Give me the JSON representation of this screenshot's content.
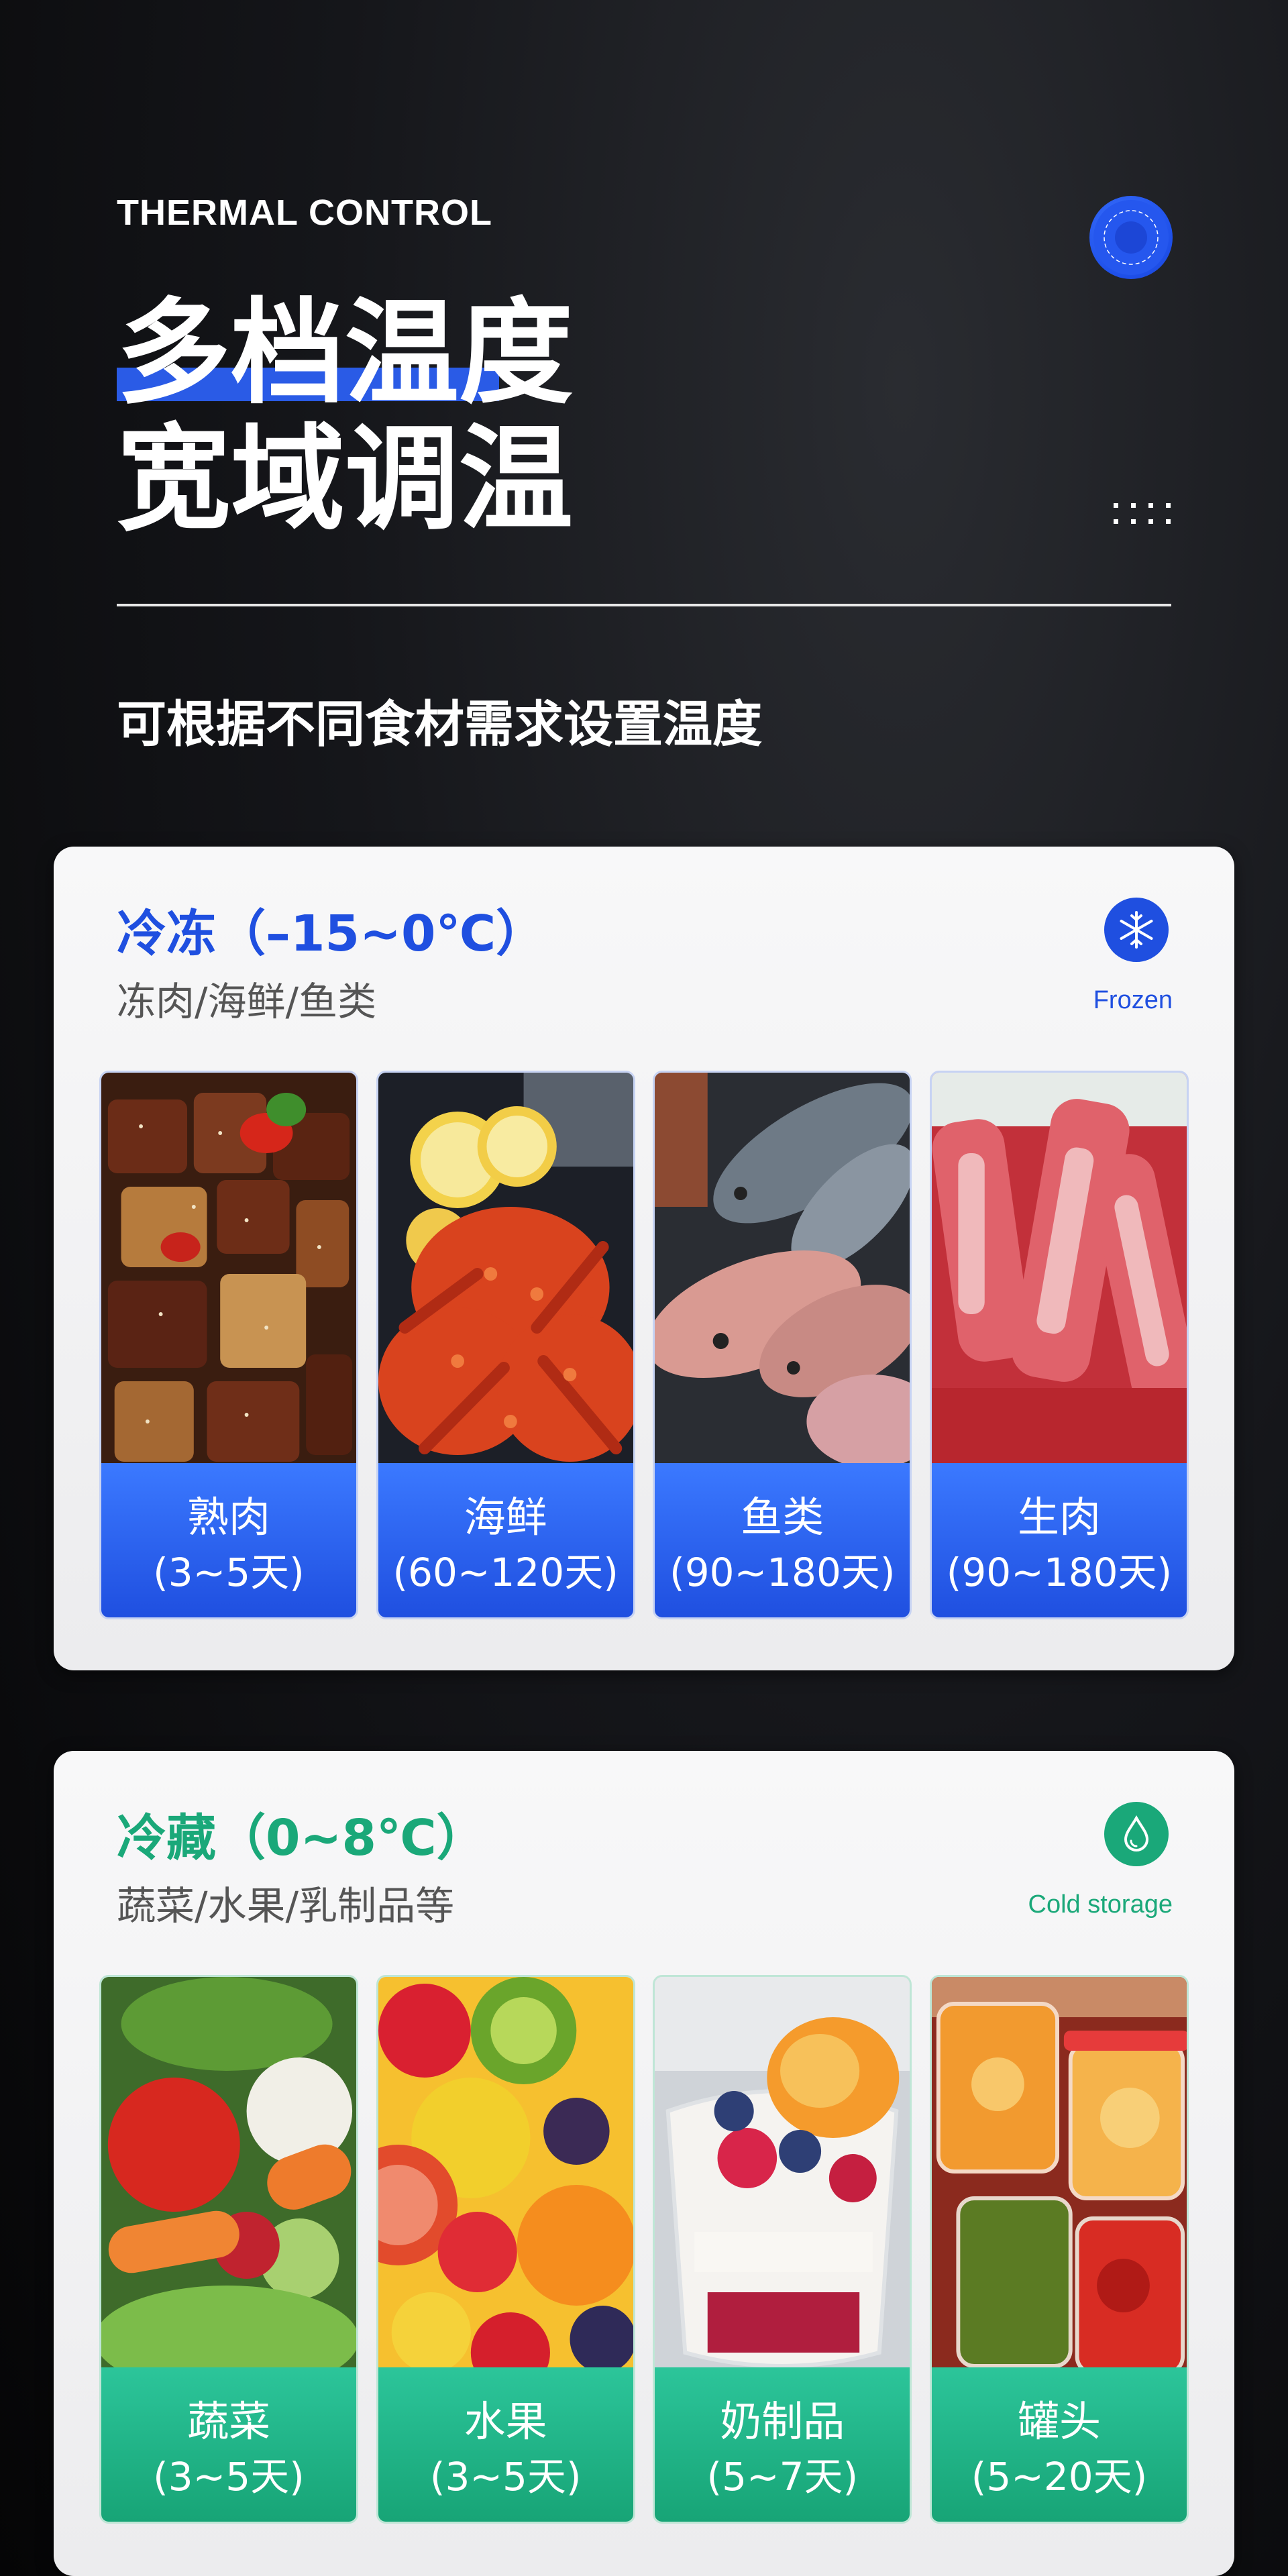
{
  "header": {
    "eyebrow": "THERMAL CONTROL",
    "title_line1": "多档温度",
    "title_line2": "宽域调温",
    "subtitle": "可根据不同食材需求设置温度"
  },
  "colors": {
    "accent_blue": "#1f4fe0",
    "accent_green": "#1aa879",
    "background": "#0b0b0d"
  },
  "frozen": {
    "title": "冷冻（–15~0℃）",
    "subtitle": "冻肉/海鲜/鱼类",
    "en_label": "Frozen",
    "icon": "snowflake-icon",
    "items": [
      {
        "name": "熟肉",
        "days": "(3~5天)"
      },
      {
        "name": "海鲜",
        "days": "(60~120天)"
      },
      {
        "name": "鱼类",
        "days": "(90~180天)"
      },
      {
        "name": "生肉",
        "days": "(90~180天)"
      }
    ]
  },
  "cold": {
    "title": "冷藏（0~8℃）",
    "subtitle": "蔬菜/水果/乳制品等",
    "en_label": "Cold storage",
    "icon": "water-drop-icon",
    "items": [
      {
        "name": "蔬菜",
        "days": "(3~5天)"
      },
      {
        "name": "水果",
        "days": "(3~5天)"
      },
      {
        "name": "奶制品",
        "days": "(5~7天)"
      },
      {
        "name": "罐头",
        "days": "(5~20天)"
      }
    ]
  }
}
